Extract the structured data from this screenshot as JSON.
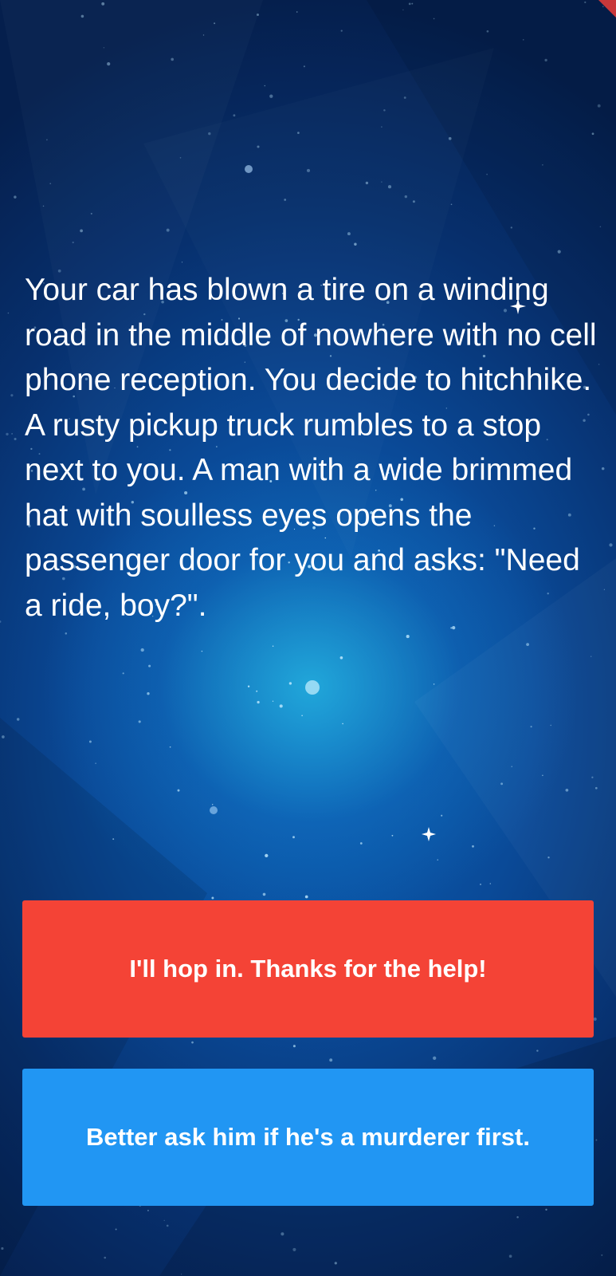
{
  "story": {
    "text": "Your car has blown a tire on a winding road in the middle of nowhere with no cell phone reception. You decide to hitchhike. A rusty pickup truck rumbles to a stop next to you. A man with a wide brimmed hat with soulless eyes opens the passenger door for you and asks: \"Need a ride, boy?\"."
  },
  "choices": [
    {
      "label": "I'll hop in. Thanks for the help!",
      "color": "#f44336"
    },
    {
      "label": "Better ask him if he's a murderer first.",
      "color": "#2196f3"
    }
  ],
  "theme": {
    "background_top": "#051f4d",
    "background_center": "#0b63b8",
    "glow": "#28bee6",
    "corner_accent": "#c8383a"
  }
}
